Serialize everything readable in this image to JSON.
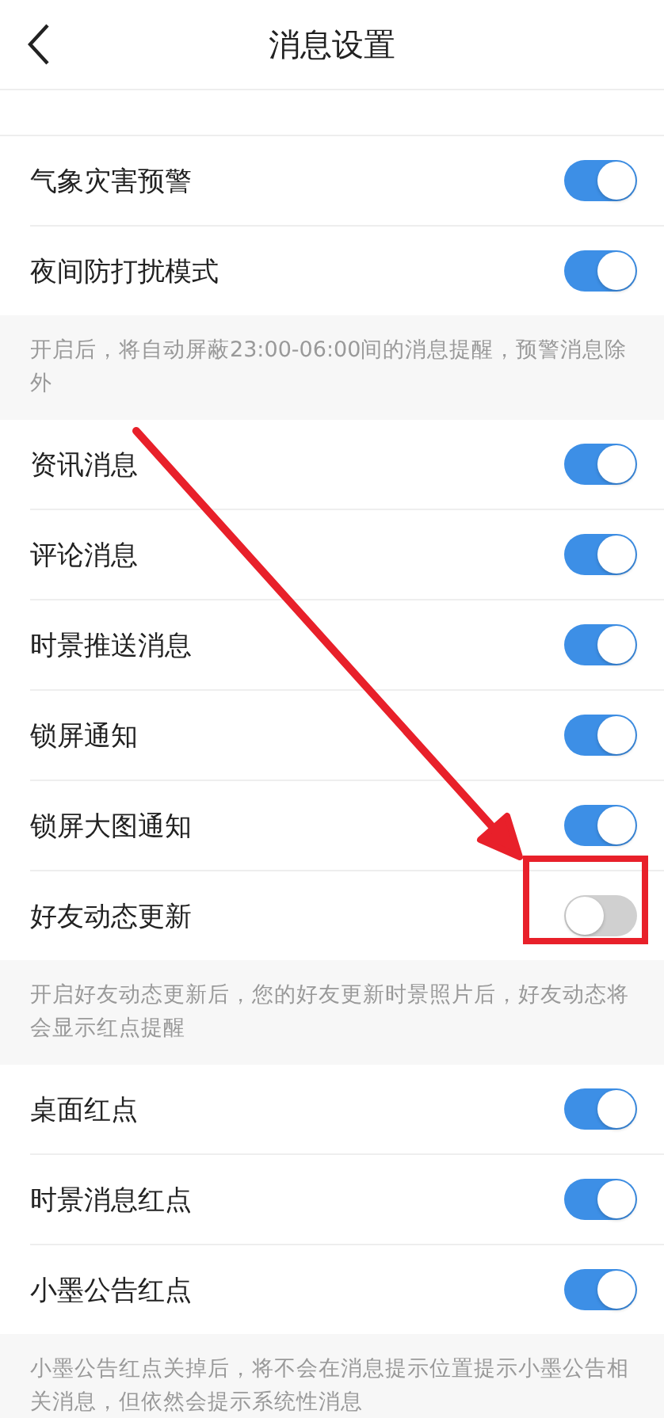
{
  "header": {
    "title": "消息设置"
  },
  "sections": [
    {
      "rows": [
        {
          "label": "气象灾害预警",
          "on": true
        },
        {
          "label": "夜间防打扰模式",
          "on": true
        }
      ],
      "note": "开启后，将自动屏蔽23:00-06:00间的消息提醒，预警消息除外"
    },
    {
      "rows": [
        {
          "label": "资讯消息",
          "on": true
        },
        {
          "label": "评论消息",
          "on": true
        },
        {
          "label": "时景推送消息",
          "on": true
        },
        {
          "label": "锁屏通知",
          "on": true
        },
        {
          "label": "锁屏大图通知",
          "on": true
        },
        {
          "label": "好友动态更新",
          "on": false
        }
      ],
      "note": "开启好友动态更新后，您的好友更新时景照片后，好友动态将会显示红点提醒"
    },
    {
      "rows": [
        {
          "label": "桌面红点",
          "on": true
        },
        {
          "label": "时景消息红点",
          "on": true
        },
        {
          "label": "小墨公告红点",
          "on": true
        }
      ],
      "note": "小墨公告红点关掉后，将不会在消息提示位置提示小墨公告相关消息，但依然会提示系统性消息"
    }
  ]
}
